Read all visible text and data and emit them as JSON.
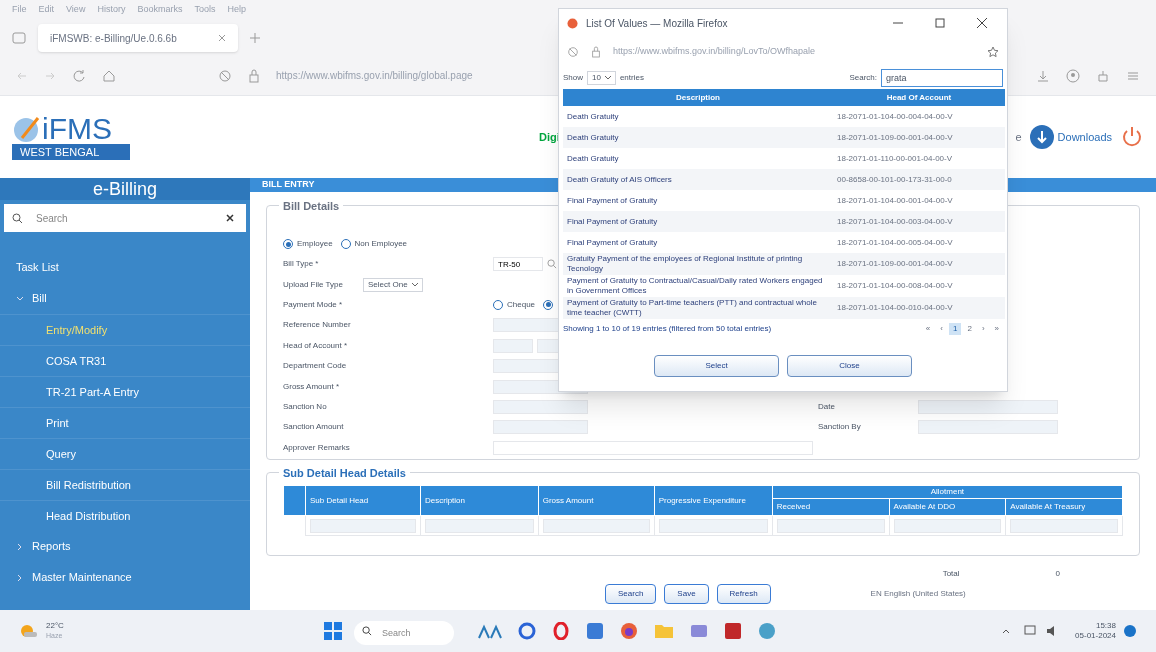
{
  "browser": {
    "menu": [
      "File",
      "Edit",
      "View",
      "History",
      "Bookmarks",
      "Tools",
      "Help"
    ],
    "tab_title": "iFMSWB: e-Billing/Ue.0.6.6b",
    "url": "https://www.wbifms.gov.in/billing/global.page"
  },
  "header": {
    "logo_title": "iFMS",
    "logo_subtitle": "WEST BENGAL",
    "banner_text": "Digi",
    "side_text": "e",
    "downloads": "Downloads"
  },
  "sidebar": {
    "title": "e-Billing",
    "search_placeholder": "Search",
    "items": [
      {
        "label": "Task List",
        "kind": "heading"
      },
      {
        "label": "Bill",
        "kind": "group",
        "expanded": true,
        "children": [
          {
            "label": "Entry/Modify",
            "selected": true
          },
          {
            "label": "COSA TR31",
            "selected": false
          },
          {
            "label": "TR-21 Part-A Entry",
            "selected": false
          },
          {
            "label": "Print",
            "selected": false
          },
          {
            "label": "Query",
            "selected": false
          },
          {
            "label": "Bill Redistribution",
            "selected": false
          },
          {
            "label": "Head Distribution",
            "selected": false
          }
        ]
      },
      {
        "label": "Reports",
        "kind": "group",
        "expanded": false
      },
      {
        "label": "Master Maintenance",
        "kind": "group",
        "expanded": false
      }
    ]
  },
  "main": {
    "section_title": "BILL ENTRY",
    "bill_details": {
      "legend": "Bill Details",
      "payee": [
        {
          "label": "Employee",
          "selected": true
        },
        {
          "label": "Non Employee",
          "selected": false
        }
      ],
      "rows": [
        {
          "label": "Bill Type *",
          "kind": "lookup",
          "value": "TR-50"
        },
        {
          "label": "Upload File Type",
          "kind": "select",
          "value": "Select One"
        },
        {
          "label": "Payment Mode *",
          "kind": "radio",
          "options": [
            {
              "label": "Cheque",
              "selected": false
            },
            {
              "selected": true
            }
          ]
        },
        {
          "label": "Reference Number",
          "kind": "text"
        },
        {
          "label": "Head of Account *",
          "kind": "double"
        },
        {
          "label": "Department Code",
          "kind": "text"
        },
        {
          "label": "Gross Amount *",
          "kind": "text"
        },
        {
          "label": "Sanction No",
          "kind": "text",
          "right_label": "Date"
        },
        {
          "label": "Sanction Amount",
          "kind": "text",
          "right_label": "Sanction By"
        },
        {
          "label": "Approver Remarks",
          "kind": "wide"
        }
      ]
    },
    "sub_detail": {
      "legend": "Sub Detail Head Details",
      "columns": [
        "Sub Detail Head",
        "Description",
        "Gross Amount",
        "Progressive Expenditure"
      ],
      "group_column": "Allotment",
      "group_subcolumns": [
        "Received",
        "Available At DDO",
        "Available At Treasury"
      ]
    },
    "total_label": "Total",
    "total_value": "0",
    "buttons": [
      "Search",
      "Save",
      "Refresh"
    ],
    "language_tip": "EN English (United States)"
  },
  "popup": {
    "title": "List Of Values — Mozilla Firefox",
    "url": "https://www.wbifms.gov.in/billing/LovTo/OWfhapale",
    "show_label": "Show",
    "page_size": "10",
    "entries_label": "entries",
    "search_label": "Search:",
    "search_value": "grata",
    "columns": [
      "Description",
      "Head Of Account"
    ],
    "rows": [
      {
        "description": "Death Gratuity",
        "head": "18-2071-01-104-00-004-04-00-V"
      },
      {
        "description": "Death Gratuity",
        "head": "18-2071-01-109-00-001-04-00-V"
      },
      {
        "description": "Death Gratuity",
        "head": "18-2071-01-110-00-001-04-00-V"
      },
      {
        "description": "Death Gratuity of AIS Officers",
        "head": "00-8658-00-101-00-173-31-00-0"
      },
      {
        "description": "Final Payment of Gratuity",
        "head": "18-2071-01-104-00-001-04-00-V"
      },
      {
        "description": "Final Payment of Gratuity",
        "head": "18-2071-01-104-00-003-04-00-V"
      },
      {
        "description": "Final Payment of Gratuity",
        "head": "18-2071-01-104-00-005-04-00-V"
      },
      {
        "description": "Gratuity Payment of the employees of Regional Institute of printing Tecnology",
        "head": "18-2071-01-109-00-001-04-00-V"
      },
      {
        "description": "Payment of Gratuity to Contractual/Casual/Daily rated Workers engaged in Government Offices",
        "head": "18-2071-01-104-00-008-04-00-V"
      },
      {
        "description": "Payment of Gratuity to Part-time teachers (PTT) and contractual whole time teacher (CWTT)",
        "head": "18-2071-01-104-00-010-04-00-V"
      }
    ],
    "info": "Showing 1 to 10 of 19 entries (filtered from 50 total entries)",
    "pages": [
      {
        "label": "«",
        "selected": false
      },
      {
        "label": "‹",
        "selected": false
      },
      {
        "label": "1",
        "selected": true
      },
      {
        "label": "2",
        "selected": false
      },
      {
        "label": "›",
        "selected": false
      },
      {
        "label": "»",
        "selected": false
      }
    ],
    "buttons": [
      "Select",
      "Close"
    ]
  },
  "taskbar": {
    "temperature": "22°C",
    "weather": "Haze",
    "search_placeholder": "Search",
    "time": "15:38",
    "date": "05-01-2024"
  }
}
